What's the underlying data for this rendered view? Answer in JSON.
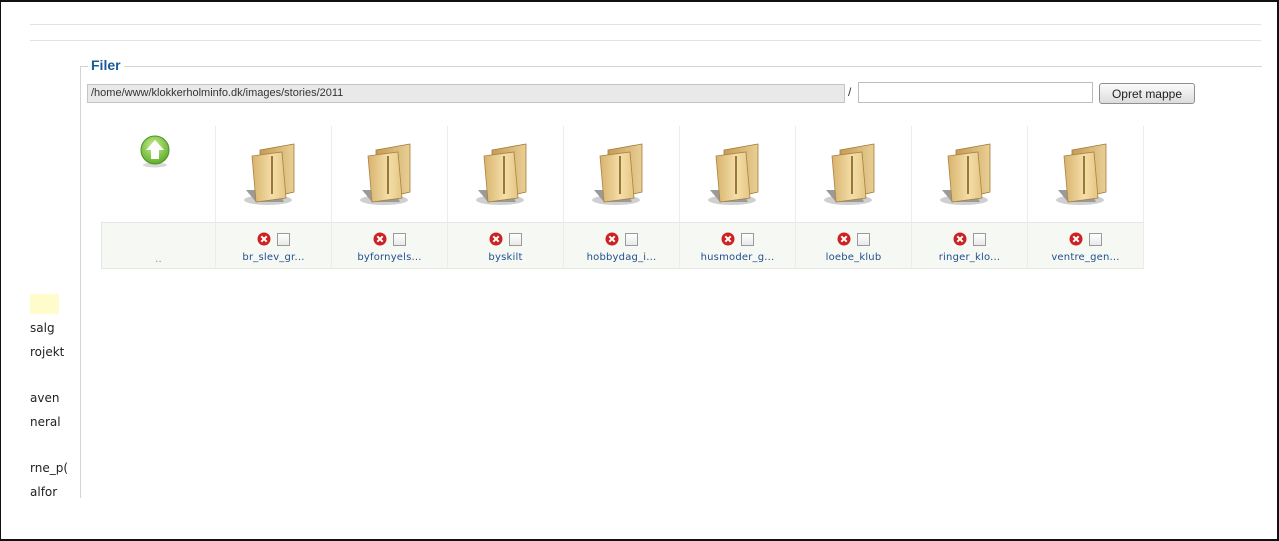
{
  "tree": {
    "items": [
      "salg",
      "rojekt",
      "aven",
      "neral",
      "rne_p(",
      "alfor"
    ]
  },
  "panel": {
    "legend": "Filer",
    "path": "/home/www/klokkerholminfo.dk/images/stories/2011",
    "separator": "/",
    "new_folder_value": "",
    "create_button": "Opret mappe"
  },
  "up_item": {
    "label": ".."
  },
  "folders": [
    {
      "label": "br_slev_gr..."
    },
    {
      "label": "byfornyels..."
    },
    {
      "label": "byskilt"
    },
    {
      "label": "hobbydag_i..."
    },
    {
      "label": "husmoder_g..."
    },
    {
      "label": "loebe_klub"
    },
    {
      "label": "ringer_klo..."
    },
    {
      "label": "ventre_gen..."
    }
  ],
  "colors": {
    "legend": "#1a5a9a",
    "link": "#1f4f8f",
    "delete": "#cc2222",
    "up": "#7cc040"
  }
}
